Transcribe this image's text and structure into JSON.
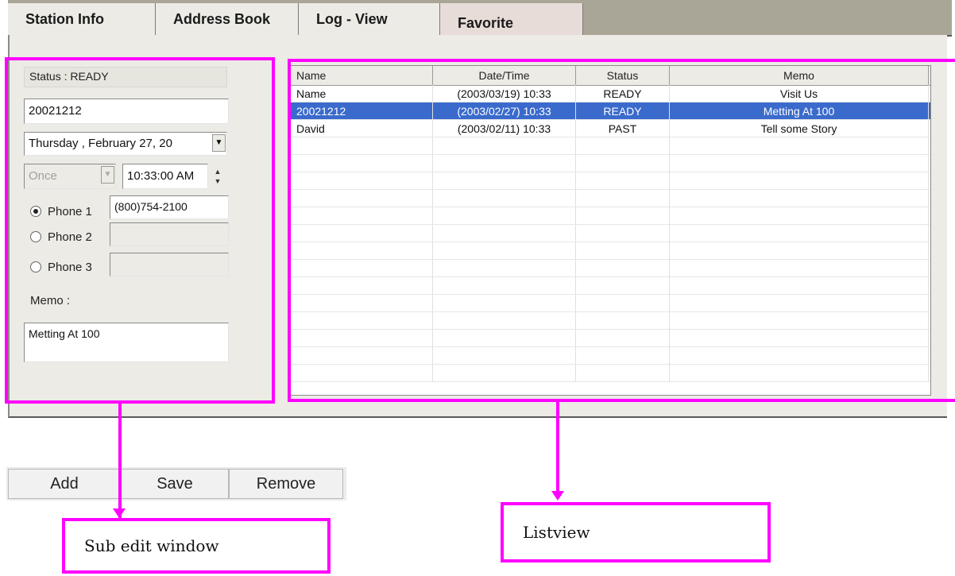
{
  "tabs": [
    {
      "label": "Station Info"
    },
    {
      "label": "Address Book"
    },
    {
      "label": "Log - View"
    },
    {
      "label": "Favorite"
    }
  ],
  "sub_edit": {
    "status_text": "Status : READY",
    "name_value": "20021212",
    "date_value": "Thursday  ,  February  27, 20",
    "repeat_value": "Once",
    "time_value": "10:33:00 AM",
    "phones": [
      {
        "label": "Phone 1",
        "value": "(800)754-2100",
        "checked": true
      },
      {
        "label": "Phone 2",
        "value": "",
        "checked": false
      },
      {
        "label": "Phone 3",
        "value": "",
        "checked": false
      }
    ],
    "memo_label": "Memo :",
    "memo_value": "Metting At 100"
  },
  "listview": {
    "columns": [
      "Name",
      "Date/Time",
      "Status",
      "Memo"
    ],
    "rows": [
      {
        "name": "Name",
        "datetime": "(2003/03/19) 10:33",
        "status": "READY",
        "memo": "Visit Us"
      },
      {
        "name": "20021212",
        "datetime": "(2003/02/27) 10:33",
        "status": "READY",
        "memo": "Metting At 100"
      },
      {
        "name": "David",
        "datetime": "(2003/02/11) 10:33",
        "status": "PAST",
        "memo": "Tell some Story"
      }
    ],
    "selected_row": 1
  },
  "buttons": {
    "add": "Add",
    "save": "Save",
    "remove": "Remove"
  },
  "annotations": {
    "sub_edit_label": "Sub edit window",
    "listview_label": "Listview"
  },
  "colors": {
    "annotation": "#ff00ff",
    "selection": "#3a6acc"
  }
}
